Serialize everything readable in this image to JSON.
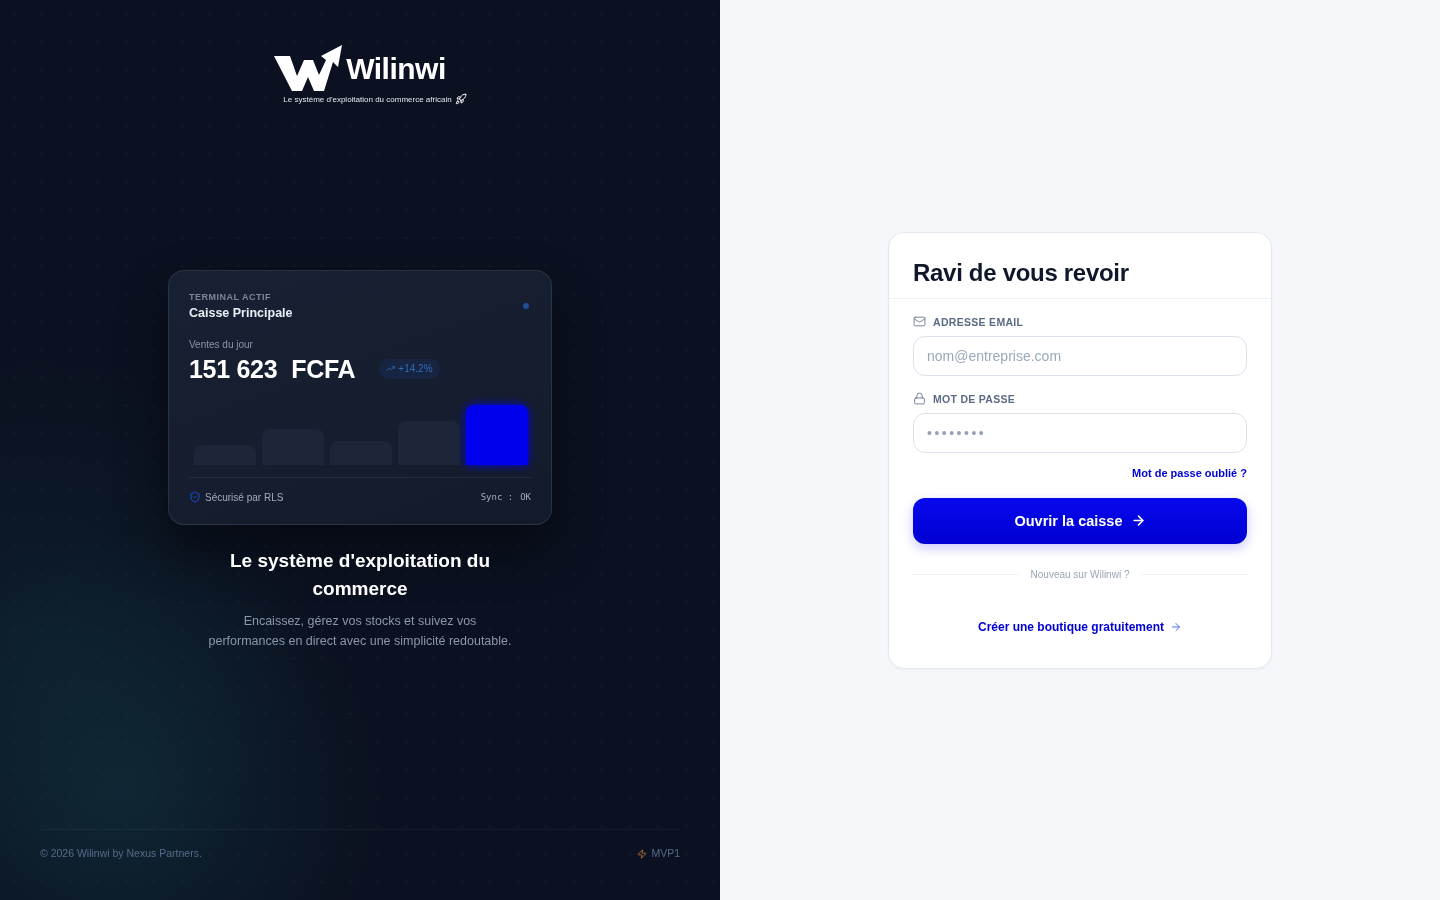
{
  "brand": {
    "name": "Wilinwi",
    "tagline": "Le système d'exploitation du commerce africain"
  },
  "terminal": {
    "label": "TERMINAL ACTIF",
    "name": "Caisse Principale",
    "active": true,
    "sales_label": "Ventes du jour",
    "amount": "151 623",
    "currency": "FCFA",
    "trend": "+14.2%",
    "security": "Sécurisé par RLS",
    "sync_label": "Sync :",
    "sync_status": "OK"
  },
  "pitch": {
    "title": "Le système d'exploitation du commerce",
    "text": "Encaissez, gérez vos stocks et suivez vos performances en direct avec une simplicité redoutable."
  },
  "footer": {
    "copyright": "© 2026 Wilinwi by Nexus Partners.",
    "version": "MVP1"
  },
  "login": {
    "title": "Ravi de vous revoir",
    "fields": [
      {
        "kind": "email",
        "label": "ADRESSE EMAIL",
        "placeholder": "nom@entreprise.com"
      },
      {
        "kind": "password",
        "label": "MOT DE PASSE",
        "value": "••••••••"
      }
    ],
    "forgot_link": "Mot de passe oublié ?",
    "submit": "Ouvrir la caisse",
    "divider": "Nouveau sur Wilinwi ?",
    "signup_link": "Créer une boutique gratuitement"
  }
}
